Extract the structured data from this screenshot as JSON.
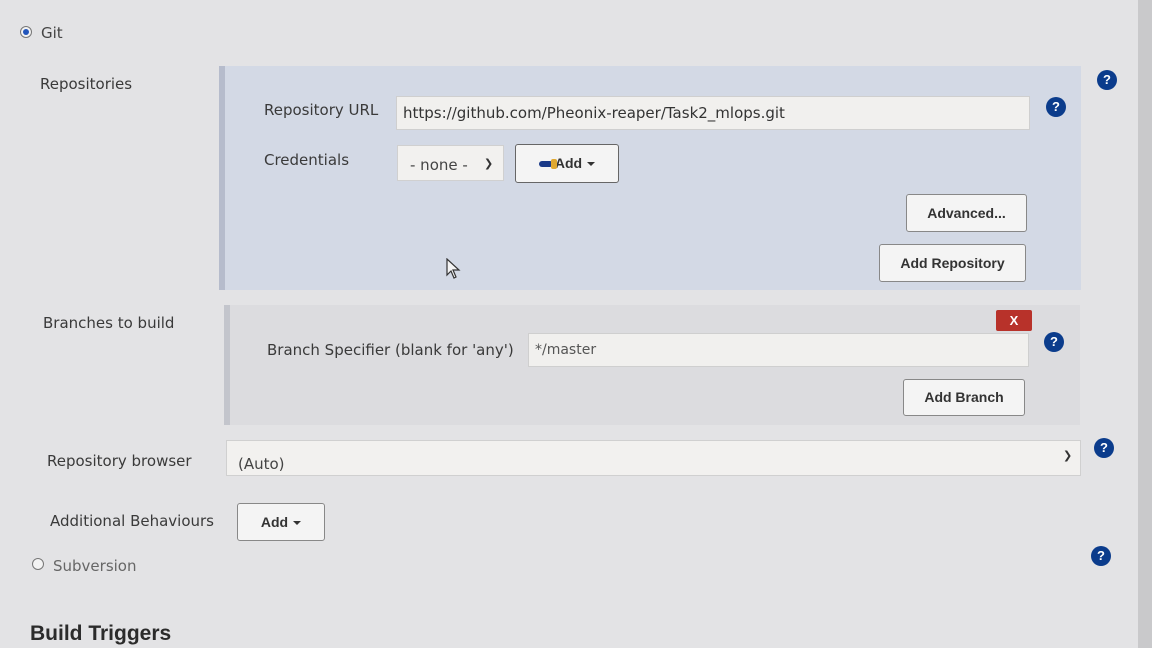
{
  "scm_options": {
    "git": {
      "label": "Git",
      "selected": true
    },
    "subversion": {
      "label": "Subversion",
      "selected": false
    }
  },
  "repositories": {
    "section_label": "Repositories",
    "url_label": "Repository URL",
    "url_value": "https://github.com/Pheonix-reaper/Task2_mlops.git",
    "credentials_label": "Credentials",
    "credentials_value": "- none -",
    "add_label": "Add",
    "advanced_label": "Advanced...",
    "add_repository_label": "Add Repository"
  },
  "branches": {
    "section_label": "Branches to build",
    "delete_label": "X",
    "specifier_label": "Branch Specifier (blank for 'any')",
    "specifier_value": "*/master",
    "add_branch_label": "Add Branch"
  },
  "repository_browser": {
    "label": "Repository browser",
    "value": "(Auto)"
  },
  "additional_behaviours": {
    "label": "Additional Behaviours",
    "add_label": "Add"
  },
  "build_triggers": {
    "title": "Build Triggers"
  },
  "help_text": "?"
}
